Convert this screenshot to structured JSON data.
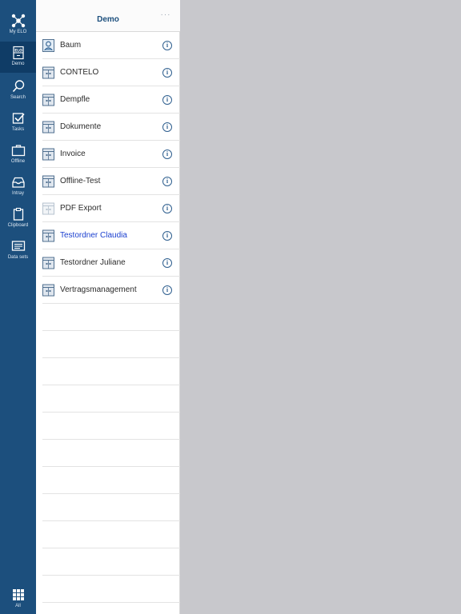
{
  "sidebar": {
    "items": [
      {
        "label": "My ELO",
        "icon": "network-icon"
      },
      {
        "label": "Demo",
        "icon": "archive-icon",
        "active": true
      },
      {
        "label": "Search",
        "icon": "search-icon"
      },
      {
        "label": "Tasks",
        "icon": "checkbox-icon"
      },
      {
        "label": "Offline",
        "icon": "briefcase-icon"
      },
      {
        "label": "Intray",
        "icon": "inbox-icon"
      },
      {
        "label": "Clipboard",
        "icon": "clipboard-icon"
      },
      {
        "label": "Data sets",
        "icon": "data-sets-icon"
      }
    ],
    "all_label": "All"
  },
  "panel": {
    "title": "Demo",
    "more": "···",
    "items": [
      {
        "label": "Baum",
        "icon": "person-folder-icon"
      },
      {
        "label": "CONTELO",
        "icon": "cabinet-icon"
      },
      {
        "label": "Dempfle",
        "icon": "cabinet-icon"
      },
      {
        "label": "Dokumente",
        "icon": "cabinet-icon"
      },
      {
        "label": "Invoice",
        "icon": "cabinet-icon"
      },
      {
        "label": "Offline-Test",
        "icon": "cabinet-icon"
      },
      {
        "label": "PDF Export",
        "icon": "cabinet-light-icon"
      },
      {
        "label": "Testordner Claudia",
        "icon": "cabinet-icon",
        "highlight": true
      },
      {
        "label": "Testordner Juliane",
        "icon": "cabinet-icon"
      },
      {
        "label": "Vertragsmanagement",
        "icon": "cabinet-icon"
      }
    ],
    "info_glyph": "i"
  },
  "colors": {
    "sidebar": "#1c4f7d",
    "sidebar_active": "#0f3c66",
    "accent": "#1c4f7d",
    "highlight_text": "#1a3fcf",
    "content_bg": "#c8c8cc"
  }
}
